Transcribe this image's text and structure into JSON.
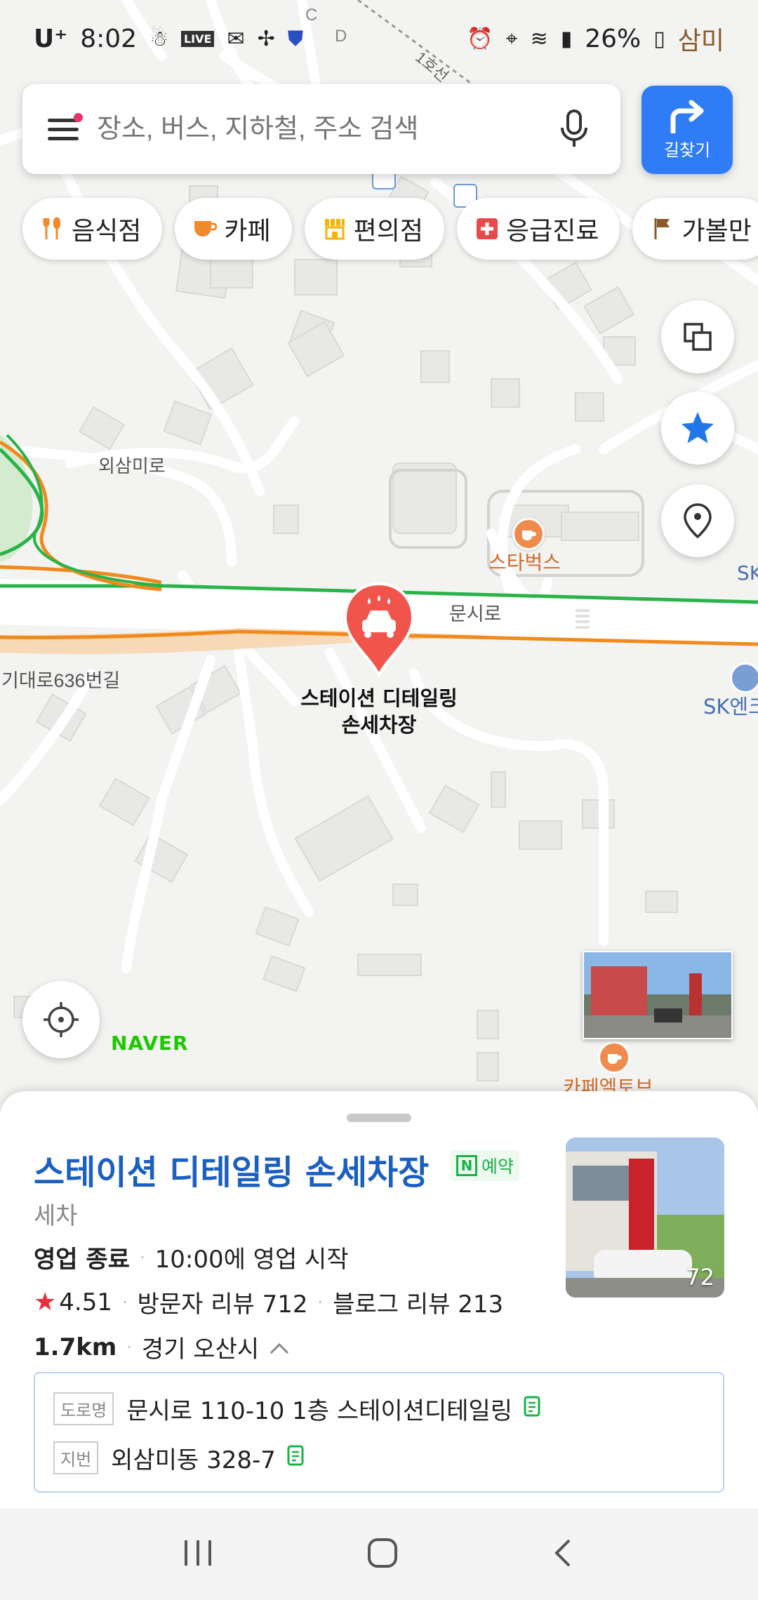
{
  "status": {
    "carrier": "U⁺",
    "time": "8:02",
    "battery": "26%",
    "live_badge": "LIVE"
  },
  "search": {
    "placeholder": "장소, 버스, 지하철, 주소 검색",
    "route_label": "길찾기"
  },
  "chips": [
    {
      "label": "음식점",
      "icon": "fork-spoon-icon",
      "color": "#f08a2c"
    },
    {
      "label": "카페",
      "icon": "cup-icon",
      "color": "#f08a2c"
    },
    {
      "label": "편의점",
      "icon": "store-icon",
      "color": "#f5b400"
    },
    {
      "label": "응급진료",
      "icon": "medical-cross-icon",
      "color": "#e64a4a"
    },
    {
      "label": "가볼만",
      "icon": "flag-icon",
      "color": "#8a5a2b"
    }
  ],
  "map": {
    "roads": {
      "oesammi": "외삼미로",
      "munsi": "문시로",
      "gidae": "기대로636번길"
    },
    "pois": {
      "starbucks": "스타벅스",
      "cafe_elltub": "카페엘토브",
      "sk": "SK엔크",
      "sk_short": "SK",
      "top_right": "삼미"
    },
    "grid_letters": [
      "C",
      "D"
    ],
    "rail_label": "1호선",
    "pin_label_line1": "스테이션 디테일링",
    "pin_label_line2": "손세차장",
    "brand": "NAVER",
    "accent_route_green": "#2bb34a",
    "accent_route_orange": "#f08a1c"
  },
  "place": {
    "title": "스테이션 디테일링 손세차장",
    "badge": "예약",
    "category": "세차",
    "status": "영업 종료",
    "hours": "10:00에 영업 시작",
    "rating": "4.51",
    "visitor_reviews": "방문자 리뷰 712",
    "blog_reviews": "블로그 리뷰 213",
    "distance": "1.7km",
    "region": "경기 오산시",
    "photo_count": "72",
    "road_tag": "도로명",
    "road_address": "문시로 110-10 1층 스테이션디테일링",
    "lot_tag": "지번",
    "lot_address": "외삼미동 328-7"
  }
}
